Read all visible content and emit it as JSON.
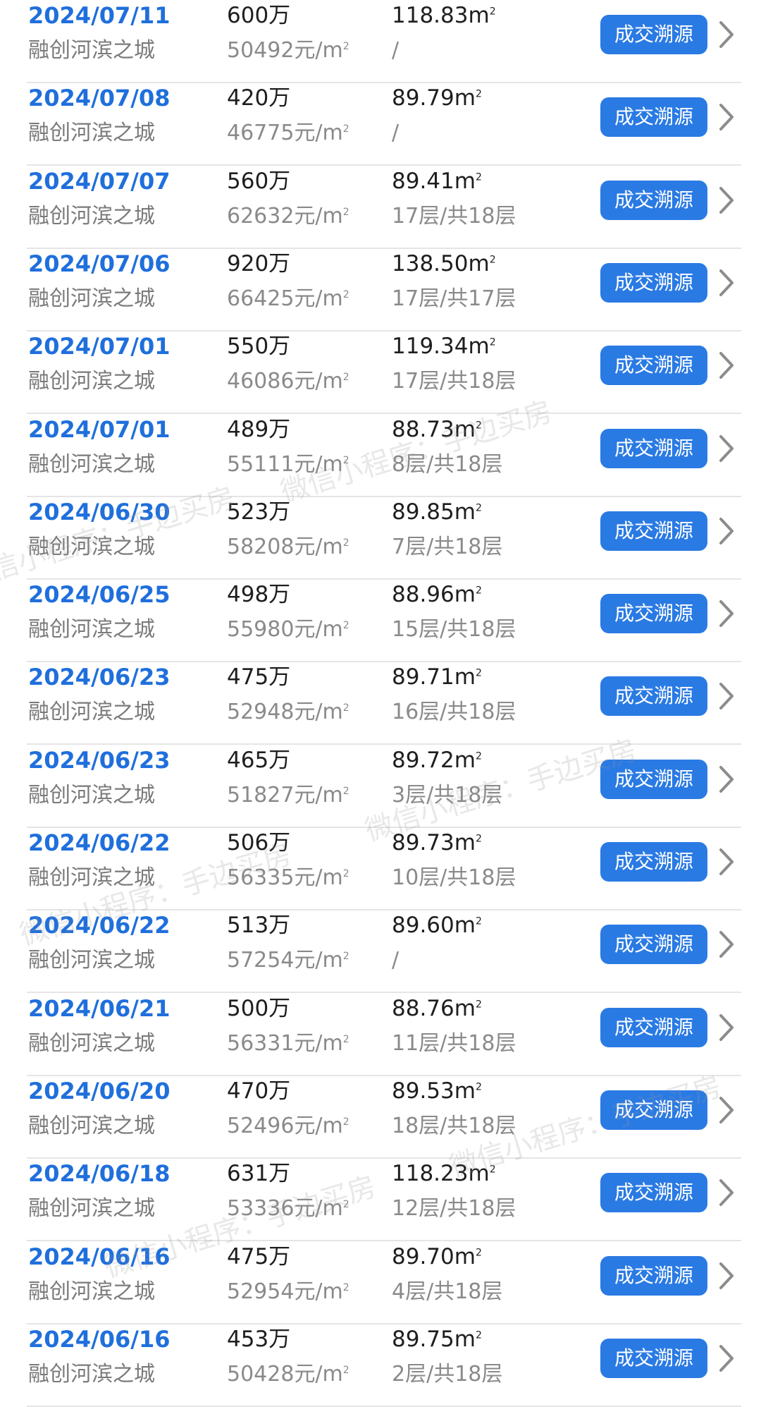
{
  "button_label": "成交溯源",
  "area_unit": "m",
  "area_sup": "2",
  "unit_price_suffix": "元/m",
  "watermark": "微信小程序：手边买房",
  "colors": {
    "date": "#1f6fdc",
    "button": "#2a7ae4"
  },
  "rows": [
    {
      "date": "2024/07/11",
      "community": "融创河滨之城",
      "price": "600万",
      "unit_price": "50492",
      "area": "118.83",
      "floor": "/"
    },
    {
      "date": "2024/07/08",
      "community": "融创河滨之城",
      "price": "420万",
      "unit_price": "46775",
      "area": "89.79",
      "floor": "/"
    },
    {
      "date": "2024/07/07",
      "community": "融创河滨之城",
      "price": "560万",
      "unit_price": "62632",
      "area": "89.41",
      "floor": "17层/共18层"
    },
    {
      "date": "2024/07/06",
      "community": "融创河滨之城",
      "price": "920万",
      "unit_price": "66425",
      "area": "138.50",
      "floor": "17层/共17层"
    },
    {
      "date": "2024/07/01",
      "community": "融创河滨之城",
      "price": "550万",
      "unit_price": "46086",
      "area": "119.34",
      "floor": "17层/共18层"
    },
    {
      "date": "2024/07/01",
      "community": "融创河滨之城",
      "price": "489万",
      "unit_price": "55111",
      "area": "88.73",
      "floor": "8层/共18层"
    },
    {
      "date": "2024/06/30",
      "community": "融创河滨之城",
      "price": "523万",
      "unit_price": "58208",
      "area": "89.85",
      "floor": "7层/共18层"
    },
    {
      "date": "2024/06/25",
      "community": "融创河滨之城",
      "price": "498万",
      "unit_price": "55980",
      "area": "88.96",
      "floor": "15层/共18层"
    },
    {
      "date": "2024/06/23",
      "community": "融创河滨之城",
      "price": "475万",
      "unit_price": "52948",
      "area": "89.71",
      "floor": "16层/共18层"
    },
    {
      "date": "2024/06/23",
      "community": "融创河滨之城",
      "price": "465万",
      "unit_price": "51827",
      "area": "89.72",
      "floor": "3层/共18层"
    },
    {
      "date": "2024/06/22",
      "community": "融创河滨之城",
      "price": "506万",
      "unit_price": "56335",
      "area": "89.73",
      "floor": "10层/共18层"
    },
    {
      "date": "2024/06/22",
      "community": "融创河滨之城",
      "price": "513万",
      "unit_price": "57254",
      "area": "89.60",
      "floor": "/"
    },
    {
      "date": "2024/06/21",
      "community": "融创河滨之城",
      "price": "500万",
      "unit_price": "56331",
      "area": "88.76",
      "floor": "11层/共18层"
    },
    {
      "date": "2024/06/20",
      "community": "融创河滨之城",
      "price": "470万",
      "unit_price": "52496",
      "area": "89.53",
      "floor": "18层/共18层"
    },
    {
      "date": "2024/06/18",
      "community": "融创河滨之城",
      "price": "631万",
      "unit_price": "53336",
      "area": "118.23",
      "floor": "12层/共18层"
    },
    {
      "date": "2024/06/16",
      "community": "融创河滨之城",
      "price": "475万",
      "unit_price": "52954",
      "area": "89.70",
      "floor": "4层/共18层"
    },
    {
      "date": "2024/06/16",
      "community": "融创河滨之城",
      "price": "453万",
      "unit_price": "50428",
      "area": "89.75",
      "floor": "2层/共18层"
    }
  ]
}
